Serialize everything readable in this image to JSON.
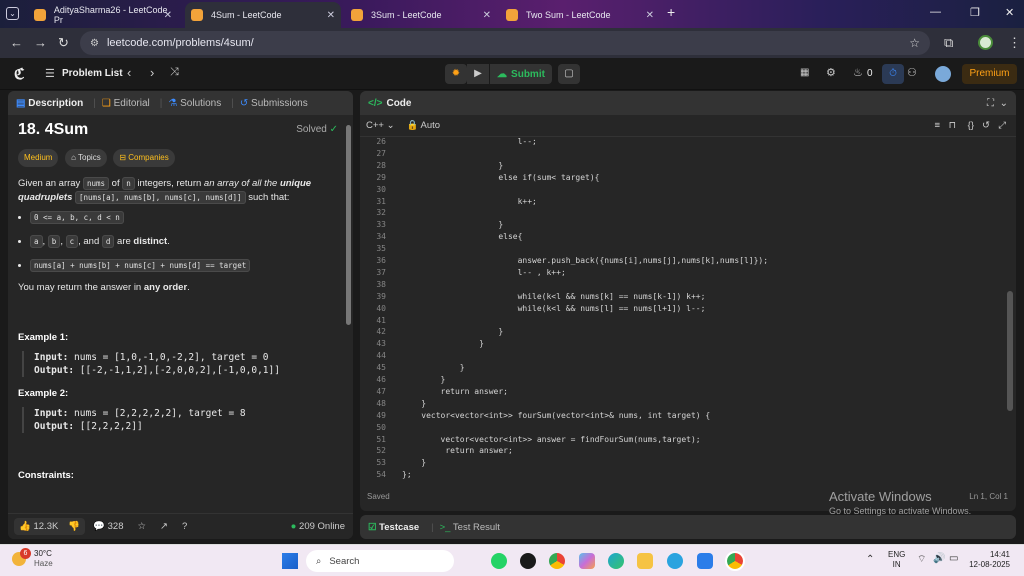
{
  "browser": {
    "tabs": [
      {
        "title": "AdityaSharma26 - LeetCode Pr",
        "active": false
      },
      {
        "title": "4Sum - LeetCode",
        "active": true
      },
      {
        "title": "3Sum - LeetCode",
        "active": false
      },
      {
        "title": "Two Sum - LeetCode",
        "active": false
      }
    ],
    "new_tab": "+",
    "url": "leetcode.com/problems/4sum/"
  },
  "lc_header": {
    "problem_list": "Problem List",
    "submit": "Submit",
    "streak": "0",
    "premium": "Premium"
  },
  "left_tabs": {
    "description": "Description",
    "editorial": "Editorial",
    "solutions": "Solutions",
    "submissions": "Submissions"
  },
  "problem": {
    "title": "18. 4Sum",
    "status": "Solved",
    "difficulty": "Medium",
    "topics": "Topics",
    "companies": "Companies",
    "intro_a": "Given an array ",
    "intro_nums": "nums",
    "intro_b": " of ",
    "intro_n": "n",
    "intro_c": " integers, return ",
    "intro_d": "an array of all the ",
    "intro_e": "unique quadruplets",
    "intro_code": "[nums[a], nums[b], nums[c], nums[d]]",
    "intro_f": " such that:",
    "bullet1": "0 <= a, b, c, d < n",
    "b2_a": "a",
    "b2_b": "b",
    "b2_c": "c",
    "b2_and": ", and ",
    "b2_d": "d",
    "b2_are": " are ",
    "b2_distinct": "distinct",
    "bullet3": "nums[a] + nums[b] + nums[c] + nums[d] == target",
    "order_a": "You may return the answer in ",
    "order_b": "any order",
    "example1": "Example 1:",
    "ex1_input_label": "Input:",
    "ex1_input": " nums = [1,0,-1,0,-2,2], target = 0",
    "ex1_output_label": "Output:",
    "ex1_output": " [[-2,-1,1,2],[-2,0,0,2],[-1,0,0,1]]",
    "example2": "Example 2:",
    "ex2_input_label": "Input:",
    "ex2_input": " nums = [2,2,2,2,2], target = 8",
    "ex2_output_label": "Output:",
    "ex2_output": " [[2,2,2,2]]",
    "constraints": "Constraints:"
  },
  "left_footer": {
    "likes": "12.3K",
    "comments": "328",
    "online": "209 Online"
  },
  "editor": {
    "title": "Code",
    "language": "C++",
    "mode": "Auto",
    "saved": "Saved",
    "cursor": "Ln 1, Col 1",
    "lines": [
      {
        "n": "26",
        "t": "                        l--;"
      },
      {
        "n": "27",
        "t": ""
      },
      {
        "n": "28",
        "t": "                    }"
      },
      {
        "n": "29",
        "t": "                    else if(sum< target){"
      },
      {
        "n": "30",
        "t": ""
      },
      {
        "n": "31",
        "t": "                        k++;"
      },
      {
        "n": "32",
        "t": ""
      },
      {
        "n": "33",
        "t": "                    }"
      },
      {
        "n": "34",
        "t": "                    else{"
      },
      {
        "n": "35",
        "t": ""
      },
      {
        "n": "36",
        "t": "                        answer.push_back({nums[i],nums[j],nums[k],nums[l]});"
      },
      {
        "n": "37",
        "t": "                        l-- , k++;"
      },
      {
        "n": "38",
        "t": ""
      },
      {
        "n": "39",
        "t": "                        while(k<l && nums[k] == nums[k-1]) k++;"
      },
      {
        "n": "40",
        "t": "                        while(k<l && nums[l] == nums[l+1]) l--;"
      },
      {
        "n": "41",
        "t": ""
      },
      {
        "n": "42",
        "t": "                    }"
      },
      {
        "n": "43",
        "t": "                }"
      },
      {
        "n": "44",
        "t": ""
      },
      {
        "n": "45",
        "t": "            }"
      },
      {
        "n": "46",
        "t": "        }"
      },
      {
        "n": "47",
        "t": "        return answer;"
      },
      {
        "n": "48",
        "t": "    }"
      },
      {
        "n": "49",
        "t": "    vector<vector<int>> fourSum(vector<int>& nums, int target) {"
      },
      {
        "n": "50",
        "t": ""
      },
      {
        "n": "51",
        "t": "        vector<vector<int>> answer = findFourSum(nums,target);"
      },
      {
        "n": "52",
        "t": "         return answer;"
      },
      {
        "n": "53",
        "t": "    }"
      },
      {
        "n": "54",
        "t": "};"
      }
    ]
  },
  "bottom_tabs": {
    "testcase": "Testcase",
    "result": "Test Result"
  },
  "watermark": {
    "line1": "Activate Windows",
    "line2": "Go to Settings to activate Windows."
  },
  "taskbar": {
    "weather_temp": "30°C",
    "weather_desc": "Haze",
    "weather_badge": "6",
    "search": "Search",
    "lang1": "ENG",
    "lang2": "IN",
    "time": "14:41",
    "date": "12-08-2025"
  },
  "colors": {
    "accent_green": "#2cbb5d",
    "premium": "#ffa116",
    "medium": "#ffc01e",
    "blue_icon": "#3d8bfd"
  }
}
